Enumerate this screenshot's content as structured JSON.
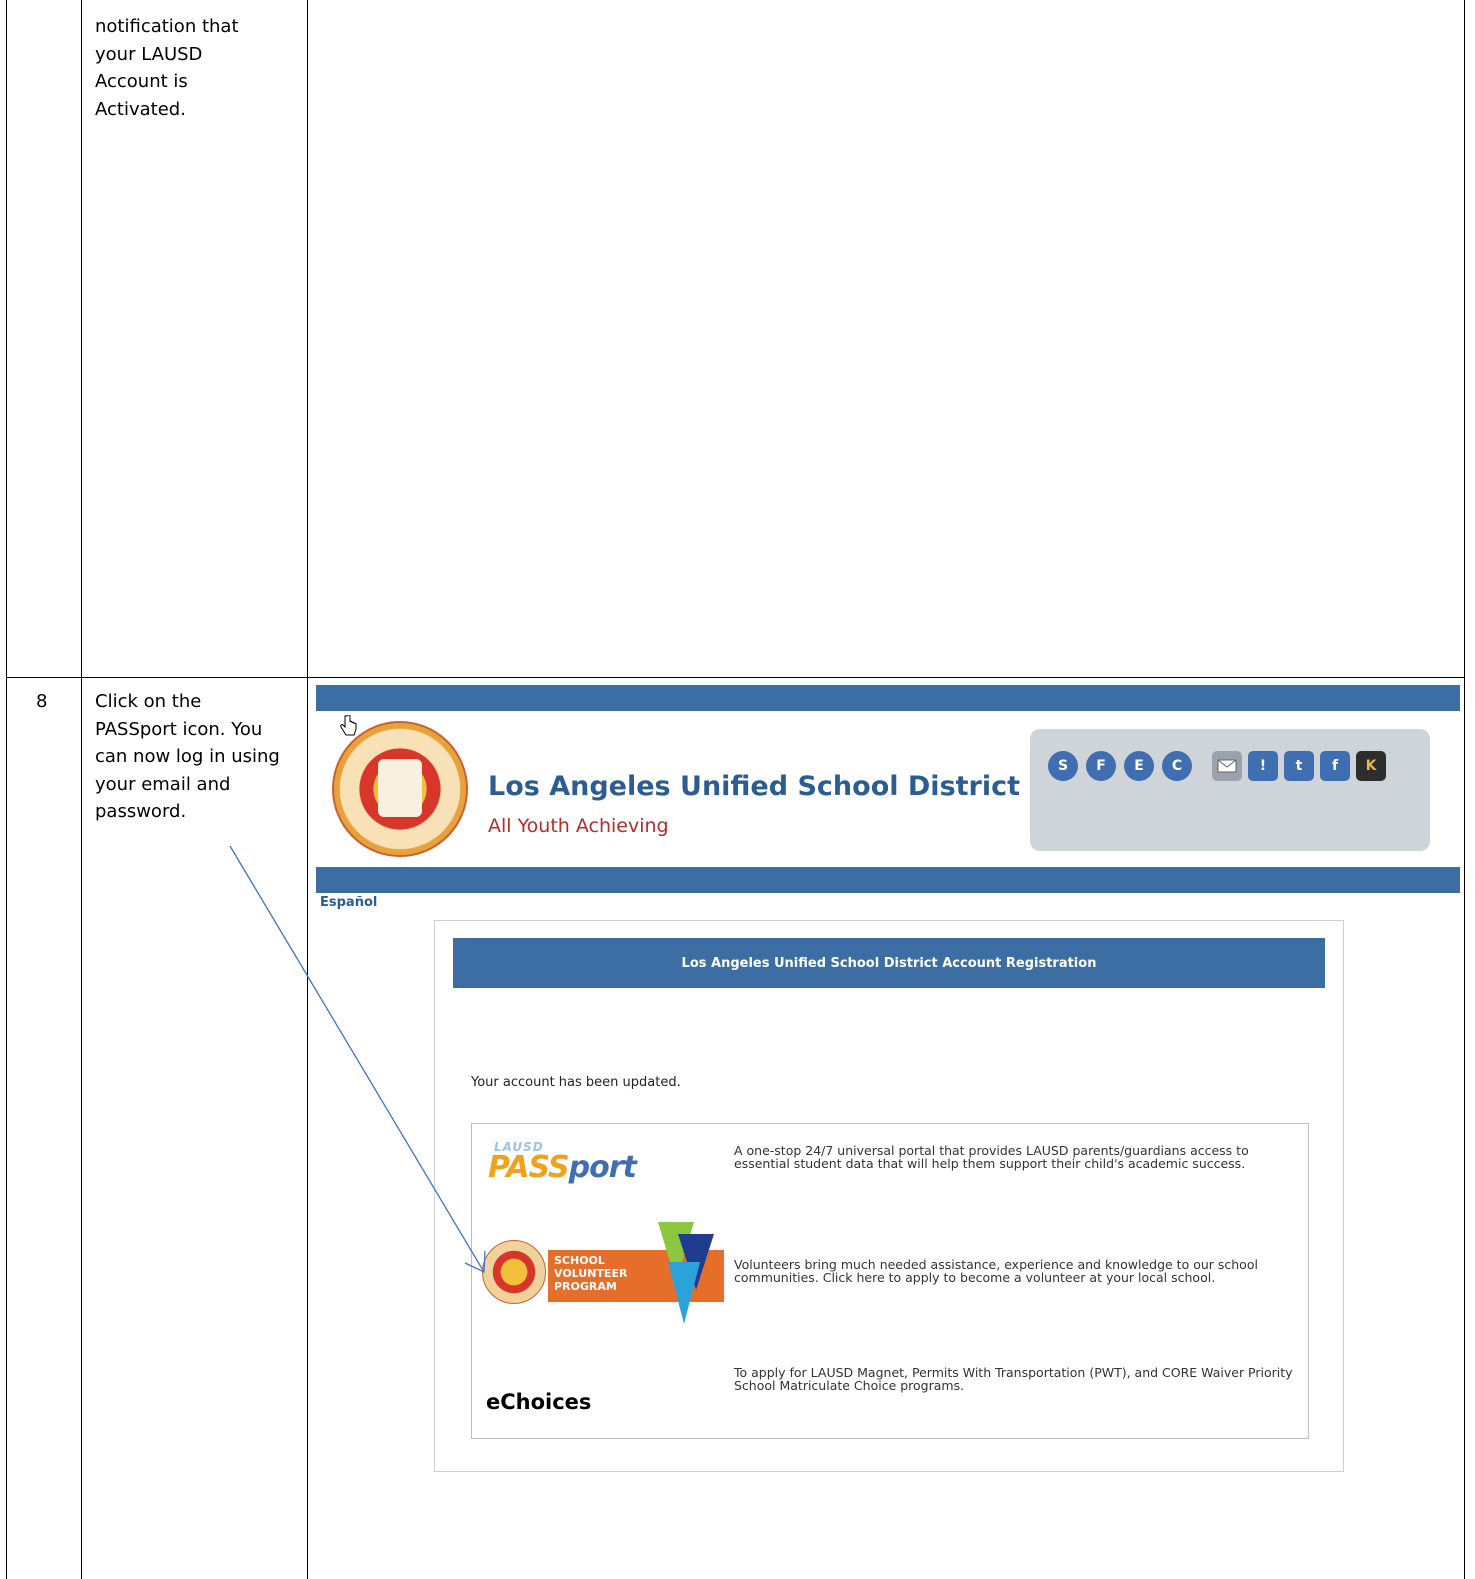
{
  "row_prev": {
    "instruction": "notification that\nyour LAUSD\nAccount is\nActivated."
  },
  "row_step8": {
    "step_number": "8",
    "instruction": "Click on the\nPASSport icon. You\ncan now log in using\nyour email and\npassword."
  },
  "site": {
    "district_name": "Los Angeles Unified School District",
    "slogan": "All Youth Achieving",
    "language_link": "Español",
    "social_icons": [
      "S",
      "F",
      "E",
      "C",
      "email-icon",
      "!",
      "t",
      "f",
      "K"
    ]
  },
  "registration": {
    "header": "Los Angeles Unified School District Account Registration",
    "status_message": "Your account has been updated.",
    "links": [
      {
        "name": "PASSport",
        "logo_top": "LAUSD",
        "logo_main": "PASS",
        "logo_port": "port",
        "description": "A one-stop 24/7 universal portal that provides LAUSD parents/guardians access to essential student data that will help them support their child's academic success."
      },
      {
        "name": "School Volunteer Program",
        "logo_text": "SCHOOL\nVOLUNTEER\nPROGRAM",
        "description": "Volunteers bring much needed assistance, experience and knowledge to our school communities. Click here to apply to become a volunteer at your local school."
      },
      {
        "name": "eChoices",
        "logo_text": "eChoices",
        "description": "To apply for LAUSD Magnet, Permits With Transportation (PWT), and CORE Waiver Priority School Matriculate Choice programs."
      }
    ]
  },
  "colors": {
    "bar_blue": "#3d6ea3",
    "title_blue": "#2b5c92",
    "slogan_red": "#b82b2b",
    "arrow_blue": "#4472c4"
  }
}
